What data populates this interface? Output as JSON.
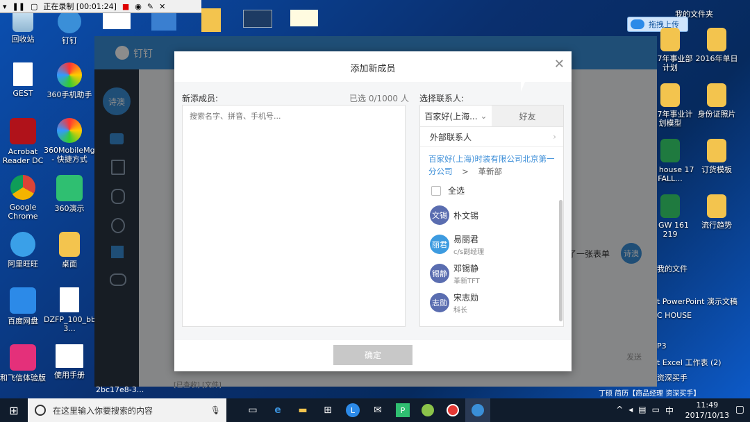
{
  "recording_bar": {
    "status": "正在录制 [00:01:24]"
  },
  "desktop": {
    "left_icons": [
      {
        "label": "回收站"
      },
      {
        "label": "钉钉"
      },
      {
        "label": "GEST"
      },
      {
        "label": "360手机助手"
      },
      {
        "label": "Acrobat Reader DC"
      },
      {
        "label": "360MobileMgr - 快捷方式"
      },
      {
        "label": "Google Chrome"
      },
      {
        "label": "360演示"
      },
      {
        "label": "阿里旺旺"
      },
      {
        "label": "桌面"
      },
      {
        "label": "百度网盘"
      },
      {
        "label": "DZFP_100_bb4183a9-3..."
      },
      {
        "label": "和飞信体验版"
      },
      {
        "label": "使用手册"
      }
    ],
    "right_header": "我的文件夹",
    "upload_label": "拖拽上传",
    "right_icons": [
      {
        "label": "017年事业部计划"
      },
      {
        "label": "2016年单日"
      },
      {
        "label": "017年事业计划模型"
      },
      {
        "label": "身份证照片"
      },
      {
        "label": "sic house 17 FALL..."
      },
      {
        "label": "订货模板"
      },
      {
        "label": "y GW 161 219"
      },
      {
        "label": "流行趋势"
      }
    ],
    "right_list_header": "我的文件",
    "right_list": [
      "t PowerPoint 演示文稿",
      "C HOUSE",
      "P3",
      "t Excel 工作表 (2)",
      "资深买手"
    ]
  },
  "dingtalk": {
    "app_name": "钉钉",
    "side_avatar": "诗澳",
    "chat_snippet": "了一张表单",
    "chat_avatar": "诗澳",
    "bottom_snippet": "[已查收] [文件]",
    "bottom_id": "2bc17e8-3...",
    "send_label": "发送",
    "status_text": "丁硕 简历【商品经理 资深买手】"
  },
  "modal": {
    "title": "添加新成员",
    "new_members_label": "新添成员:",
    "selected_count": "已选 0/1000 人",
    "search_placeholder": "搜索名字、拼音、手机号...",
    "choose_label": "选择联系人:",
    "tab_company": "百家好(上海...",
    "tab_friends": "好友",
    "external_contacts": "外部联系人",
    "breadcrumb_company": "百家好(上海)时装有限公司北京第一分公司",
    "breadcrumb_sep": ">",
    "breadcrumb_dept": "革新部",
    "select_all": "全选",
    "members": [
      {
        "avatar": "文锡",
        "name": "朴文锡",
        "title": "",
        "color": "#5a6db0"
      },
      {
        "avatar": "丽君",
        "name": "易丽君",
        "title": "c/s副经理",
        "color": "#3d9be0"
      },
      {
        "avatar": "锡静",
        "name": "邓锡静",
        "title": "革新TFT",
        "color": "#5a6db0"
      },
      {
        "avatar": "志勋",
        "name": "宋志勋",
        "title": "科长",
        "color": "#5a6db0"
      }
    ],
    "confirm": "确定"
  },
  "taskbar": {
    "search_placeholder": "在这里输入你要搜索的内容",
    "time": "11:49",
    "date": "2017/10/13",
    "ime": "中"
  },
  "colors": {
    "accent": "#3b8ed8",
    "confirm_disabled": "#c8c8c8"
  }
}
